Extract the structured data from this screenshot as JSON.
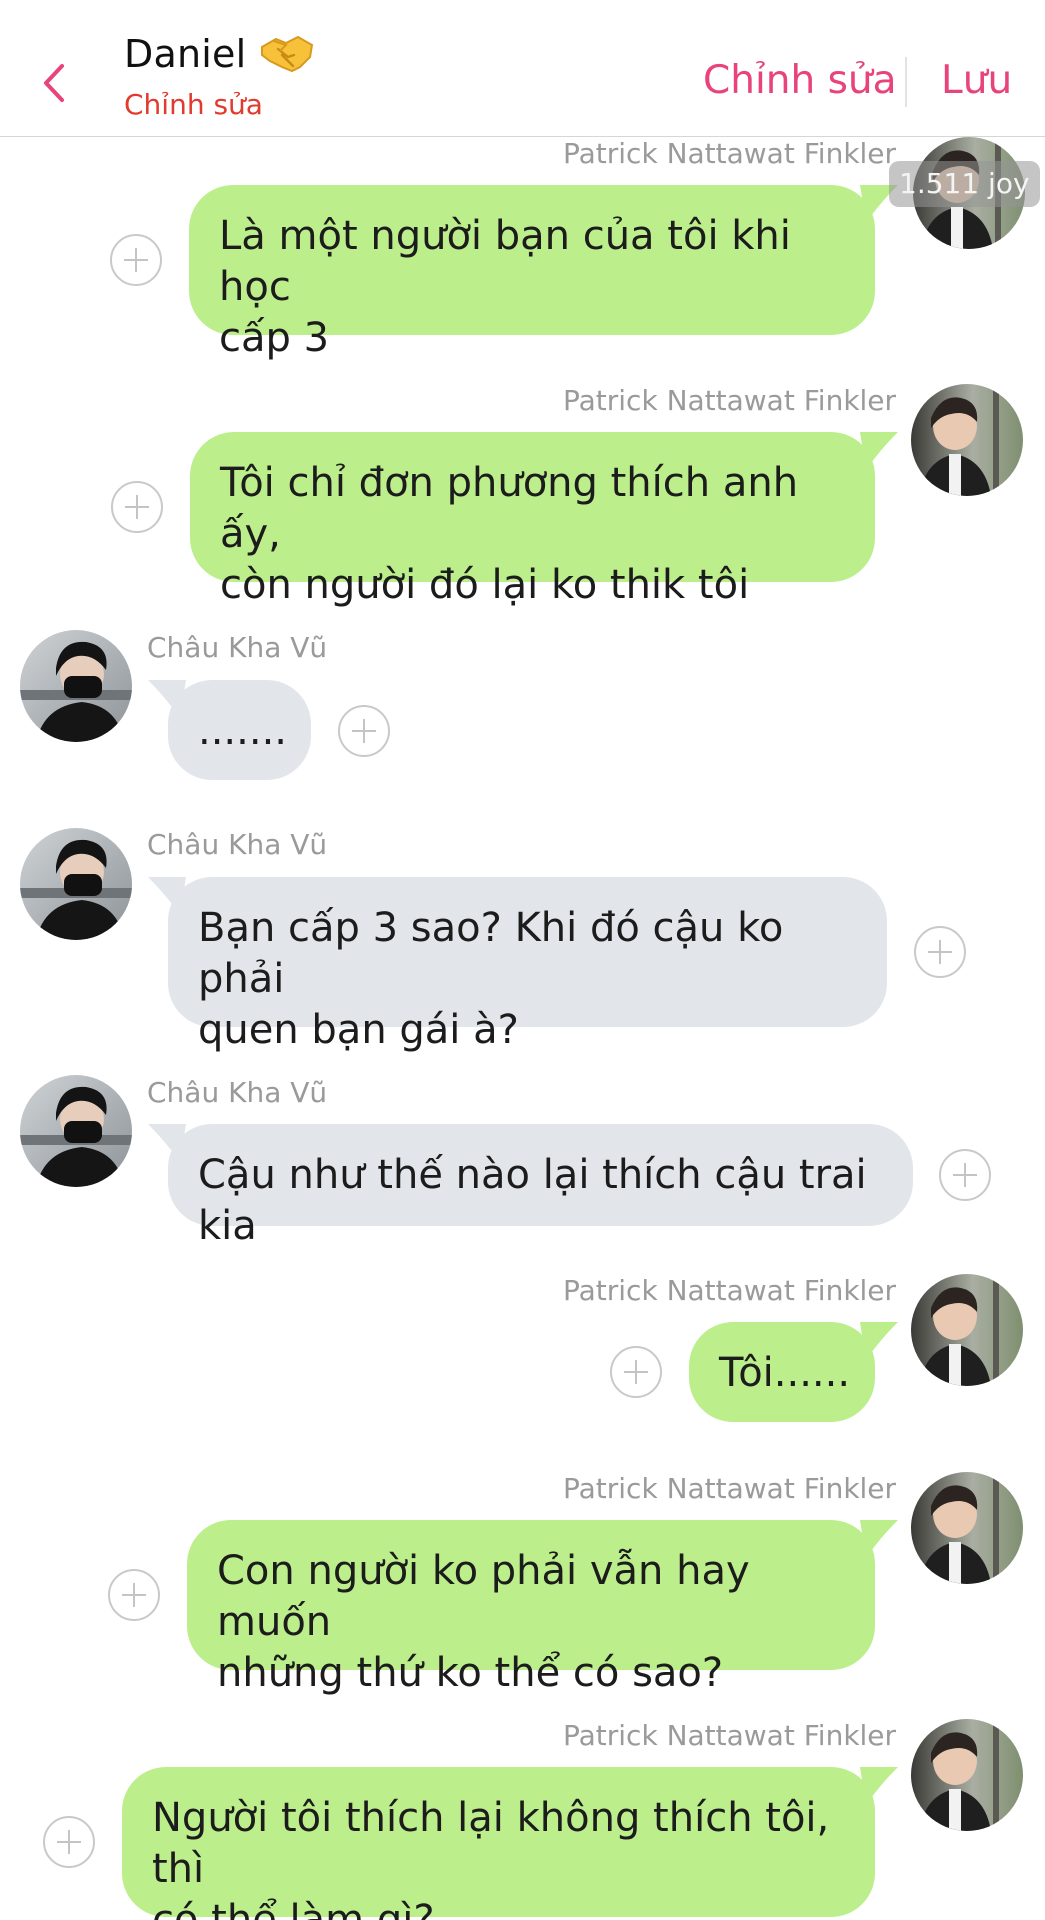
{
  "header": {
    "title": "Daniel",
    "title_emoji": "handshake-emoji",
    "subtitle": "Chỉnh sửa",
    "edit_label": "Chỉnh sửa",
    "save_label": "Lưu",
    "accent_color": "#e8437a",
    "subtitle_color": "#e23a2e"
  },
  "badge": "1.511 joy",
  "colors": {
    "green_bubble": "#bcee8c",
    "gray_bubble": "#e2e6ea"
  },
  "messages": [
    {
      "sender": "Patrick Nattawat Finkler",
      "side": "right",
      "lines": [
        "Là một người bạn của tôi khi học",
        "cấp 3"
      ]
    },
    {
      "sender": "Patrick Nattawat Finkler",
      "side": "right",
      "lines": [
        "Tôi chỉ đơn phương thích anh ấy,",
        "còn người đó lại ko thik tôi"
      ]
    },
    {
      "sender": "Châu Kha Vũ",
      "side": "left",
      "lines": [
        "......."
      ]
    },
    {
      "sender": "Châu Kha Vũ",
      "side": "left",
      "lines": [
        "Bạn cấp 3 sao? Khi đó cậu ko phải",
        "quen bạn gái à?"
      ]
    },
    {
      "sender": "Châu Kha Vũ",
      "side": "left",
      "lines": [
        "Cậu như thế nào lại thích cậu trai kia"
      ]
    },
    {
      "sender": "Patrick Nattawat Finkler",
      "side": "right",
      "lines": [
        "Tôi......"
      ]
    },
    {
      "sender": "Patrick Nattawat Finkler",
      "side": "right",
      "lines": [
        "Con người ko phải vẫn hay muốn",
        "những thứ ko thể có sao?"
      ]
    },
    {
      "sender": "Patrick Nattawat Finkler",
      "side": "right",
      "lines": [
        "Người tôi thích lại không thích tôi, thì",
        "có thể làm gì?"
      ]
    }
  ]
}
